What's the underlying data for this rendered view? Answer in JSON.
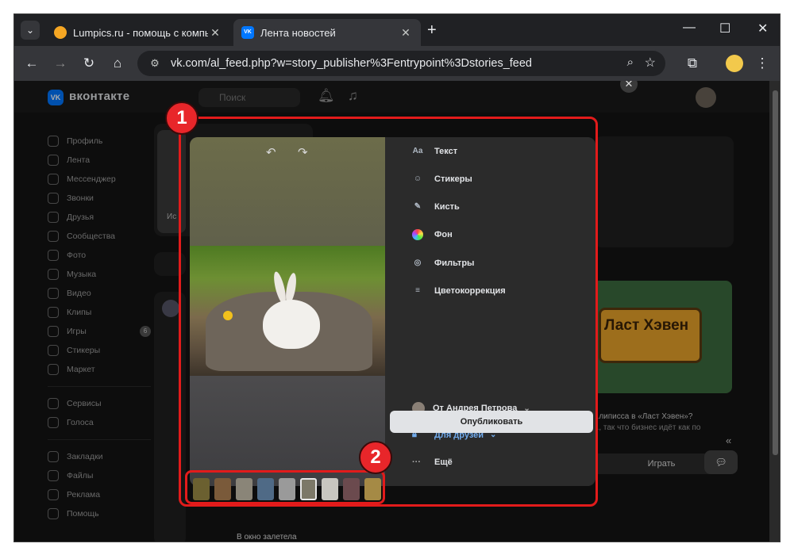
{
  "browser": {
    "tabs": [
      {
        "title": "Lumpics.ru - помощь с компь",
        "close": "✕",
        "favicon_color": "#f5a623"
      },
      {
        "title": "Лента новостей",
        "close": "✕",
        "favicon_color": "#0077ff"
      }
    ],
    "new_tab": "+",
    "url": "vk.com/al_feed.php?w=story_publisher%3Fentrypoint%3Dstories_feed",
    "window_controls": {
      "minimize": "—",
      "maximize": "☐",
      "close": "✕"
    }
  },
  "vk": {
    "logo_text": "вконтакте",
    "logo_glyph": "VK",
    "search_placeholder": "Поиск",
    "sidebar": [
      {
        "label": "Профиль"
      },
      {
        "label": "Лента"
      },
      {
        "label": "Мессенджер"
      },
      {
        "label": "Звонки"
      },
      {
        "label": "Друзья"
      },
      {
        "label": "Сообщества"
      },
      {
        "label": "Фото"
      },
      {
        "label": "Музыка"
      },
      {
        "label": "Видео"
      },
      {
        "label": "Клипы"
      },
      {
        "label": "Игры",
        "badge": "6"
      },
      {
        "label": "Стикеры"
      },
      {
        "label": "Маркет"
      }
    ],
    "sidebar2": [
      {
        "label": "Сервисы"
      },
      {
        "label": "Голоса"
      }
    ],
    "sidebar3": [
      {
        "label": "Закладки"
      },
      {
        "label": "Файлы"
      },
      {
        "label": "Реклама"
      },
      {
        "label": "Помощь"
      }
    ],
    "ad": {
      "sign_text": "Ласт Хэвен",
      "headline": "...липисса в «Ласт Хэвен»?",
      "sub": "..., так что бизнес идёт как по",
      "play": "Играть"
    },
    "story_label": "Ис",
    "chat_snippet": "В окно залетела"
  },
  "story_editor": {
    "undo_icon": "↶",
    "redo_icon": "↷",
    "tools": [
      {
        "icon": "Aa",
        "label": "Текст"
      },
      {
        "icon": "☺",
        "label": "Стикеры"
      },
      {
        "icon": "✎",
        "label": "Кисть"
      },
      {
        "icon": "",
        "label": "Фон"
      },
      {
        "icon": "◎",
        "label": "Фильтры"
      },
      {
        "icon": "≡",
        "label": "Цветокоррекция"
      }
    ],
    "author": "От Андрея Петрова",
    "privacy": "Для друзей",
    "more": "Ещё",
    "publish": "Опубликовать",
    "close": "✕",
    "thumbnails_count": 10,
    "selected_thumbnail": 6
  },
  "annotations": {
    "marker1": "1",
    "marker2": "2"
  }
}
